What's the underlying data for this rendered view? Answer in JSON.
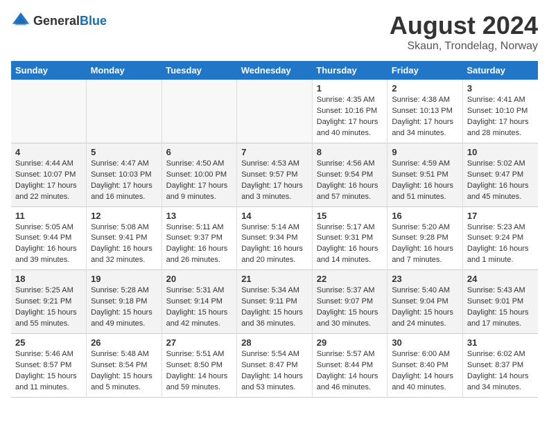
{
  "header": {
    "logo_general": "General",
    "logo_blue": "Blue",
    "title": "August 2024",
    "subtitle": "Skaun, Trondelag, Norway"
  },
  "weekdays": [
    "Sunday",
    "Monday",
    "Tuesday",
    "Wednesday",
    "Thursday",
    "Friday",
    "Saturday"
  ],
  "weeks": [
    [
      {
        "day": "",
        "info": ""
      },
      {
        "day": "",
        "info": ""
      },
      {
        "day": "",
        "info": ""
      },
      {
        "day": "",
        "info": ""
      },
      {
        "day": "1",
        "info": "Sunrise: 4:35 AM\nSunset: 10:16 PM\nDaylight: 17 hours\nand 40 minutes."
      },
      {
        "day": "2",
        "info": "Sunrise: 4:38 AM\nSunset: 10:13 PM\nDaylight: 17 hours\nand 34 minutes."
      },
      {
        "day": "3",
        "info": "Sunrise: 4:41 AM\nSunset: 10:10 PM\nDaylight: 17 hours\nand 28 minutes."
      }
    ],
    [
      {
        "day": "4",
        "info": "Sunrise: 4:44 AM\nSunset: 10:07 PM\nDaylight: 17 hours\nand 22 minutes."
      },
      {
        "day": "5",
        "info": "Sunrise: 4:47 AM\nSunset: 10:03 PM\nDaylight: 17 hours\nand 16 minutes."
      },
      {
        "day": "6",
        "info": "Sunrise: 4:50 AM\nSunset: 10:00 PM\nDaylight: 17 hours\nand 9 minutes."
      },
      {
        "day": "7",
        "info": "Sunrise: 4:53 AM\nSunset: 9:57 PM\nDaylight: 17 hours\nand 3 minutes."
      },
      {
        "day": "8",
        "info": "Sunrise: 4:56 AM\nSunset: 9:54 PM\nDaylight: 16 hours\nand 57 minutes."
      },
      {
        "day": "9",
        "info": "Sunrise: 4:59 AM\nSunset: 9:51 PM\nDaylight: 16 hours\nand 51 minutes."
      },
      {
        "day": "10",
        "info": "Sunrise: 5:02 AM\nSunset: 9:47 PM\nDaylight: 16 hours\nand 45 minutes."
      }
    ],
    [
      {
        "day": "11",
        "info": "Sunrise: 5:05 AM\nSunset: 9:44 PM\nDaylight: 16 hours\nand 39 minutes."
      },
      {
        "day": "12",
        "info": "Sunrise: 5:08 AM\nSunset: 9:41 PM\nDaylight: 16 hours\nand 32 minutes."
      },
      {
        "day": "13",
        "info": "Sunrise: 5:11 AM\nSunset: 9:37 PM\nDaylight: 16 hours\nand 26 minutes."
      },
      {
        "day": "14",
        "info": "Sunrise: 5:14 AM\nSunset: 9:34 PM\nDaylight: 16 hours\nand 20 minutes."
      },
      {
        "day": "15",
        "info": "Sunrise: 5:17 AM\nSunset: 9:31 PM\nDaylight: 16 hours\nand 14 minutes."
      },
      {
        "day": "16",
        "info": "Sunrise: 5:20 AM\nSunset: 9:28 PM\nDaylight: 16 hours\nand 7 minutes."
      },
      {
        "day": "17",
        "info": "Sunrise: 5:23 AM\nSunset: 9:24 PM\nDaylight: 16 hours\nand 1 minute."
      }
    ],
    [
      {
        "day": "18",
        "info": "Sunrise: 5:25 AM\nSunset: 9:21 PM\nDaylight: 15 hours\nand 55 minutes."
      },
      {
        "day": "19",
        "info": "Sunrise: 5:28 AM\nSunset: 9:18 PM\nDaylight: 15 hours\nand 49 minutes."
      },
      {
        "day": "20",
        "info": "Sunrise: 5:31 AM\nSunset: 9:14 PM\nDaylight: 15 hours\nand 42 minutes."
      },
      {
        "day": "21",
        "info": "Sunrise: 5:34 AM\nSunset: 9:11 PM\nDaylight: 15 hours\nand 36 minutes."
      },
      {
        "day": "22",
        "info": "Sunrise: 5:37 AM\nSunset: 9:07 PM\nDaylight: 15 hours\nand 30 minutes."
      },
      {
        "day": "23",
        "info": "Sunrise: 5:40 AM\nSunset: 9:04 PM\nDaylight: 15 hours\nand 24 minutes."
      },
      {
        "day": "24",
        "info": "Sunrise: 5:43 AM\nSunset: 9:01 PM\nDaylight: 15 hours\nand 17 minutes."
      }
    ],
    [
      {
        "day": "25",
        "info": "Sunrise: 5:46 AM\nSunset: 8:57 PM\nDaylight: 15 hours\nand 11 minutes."
      },
      {
        "day": "26",
        "info": "Sunrise: 5:48 AM\nSunset: 8:54 PM\nDaylight: 15 hours\nand 5 minutes."
      },
      {
        "day": "27",
        "info": "Sunrise: 5:51 AM\nSunset: 8:50 PM\nDaylight: 14 hours\nand 59 minutes."
      },
      {
        "day": "28",
        "info": "Sunrise: 5:54 AM\nSunset: 8:47 PM\nDaylight: 14 hours\nand 53 minutes."
      },
      {
        "day": "29",
        "info": "Sunrise: 5:57 AM\nSunset: 8:44 PM\nDaylight: 14 hours\nand 46 minutes."
      },
      {
        "day": "30",
        "info": "Sunrise: 6:00 AM\nSunset: 8:40 PM\nDaylight: 14 hours\nand 40 minutes."
      },
      {
        "day": "31",
        "info": "Sunrise: 6:02 AM\nSunset: 8:37 PM\nDaylight: 14 hours\nand 34 minutes."
      }
    ]
  ]
}
